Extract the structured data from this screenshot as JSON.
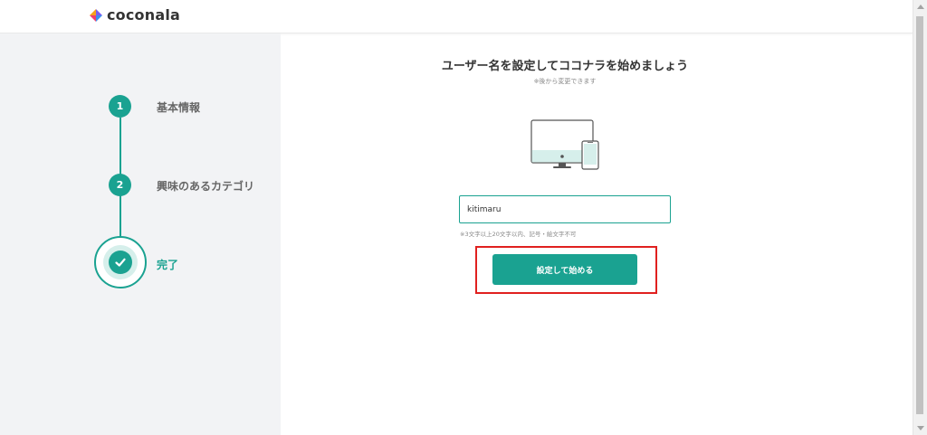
{
  "header": {
    "logo_text": "coconala"
  },
  "steps": [
    {
      "number": "1",
      "label": "基本情報",
      "state": "completed"
    },
    {
      "number": "2",
      "label": "興味のあるカテゴリ",
      "state": "completed"
    },
    {
      "number": "",
      "label": "完了",
      "state": "current"
    }
  ],
  "main": {
    "title": "ユーザー名を設定してココナラを始めましょう",
    "note": "※後から変更できます",
    "username": {
      "value": "kitimaru",
      "hint": "※3文字以上20文字以内、記号・絵文字不可"
    },
    "submit_label": "設定して始める"
  },
  "colors": {
    "accent": "#1aa291",
    "highlight": "#e0201f",
    "sidebar_bg": "#f2f3f5"
  },
  "icons": {
    "step_done": "check-icon",
    "illustration": "monitor-and-phone-illustration"
  }
}
